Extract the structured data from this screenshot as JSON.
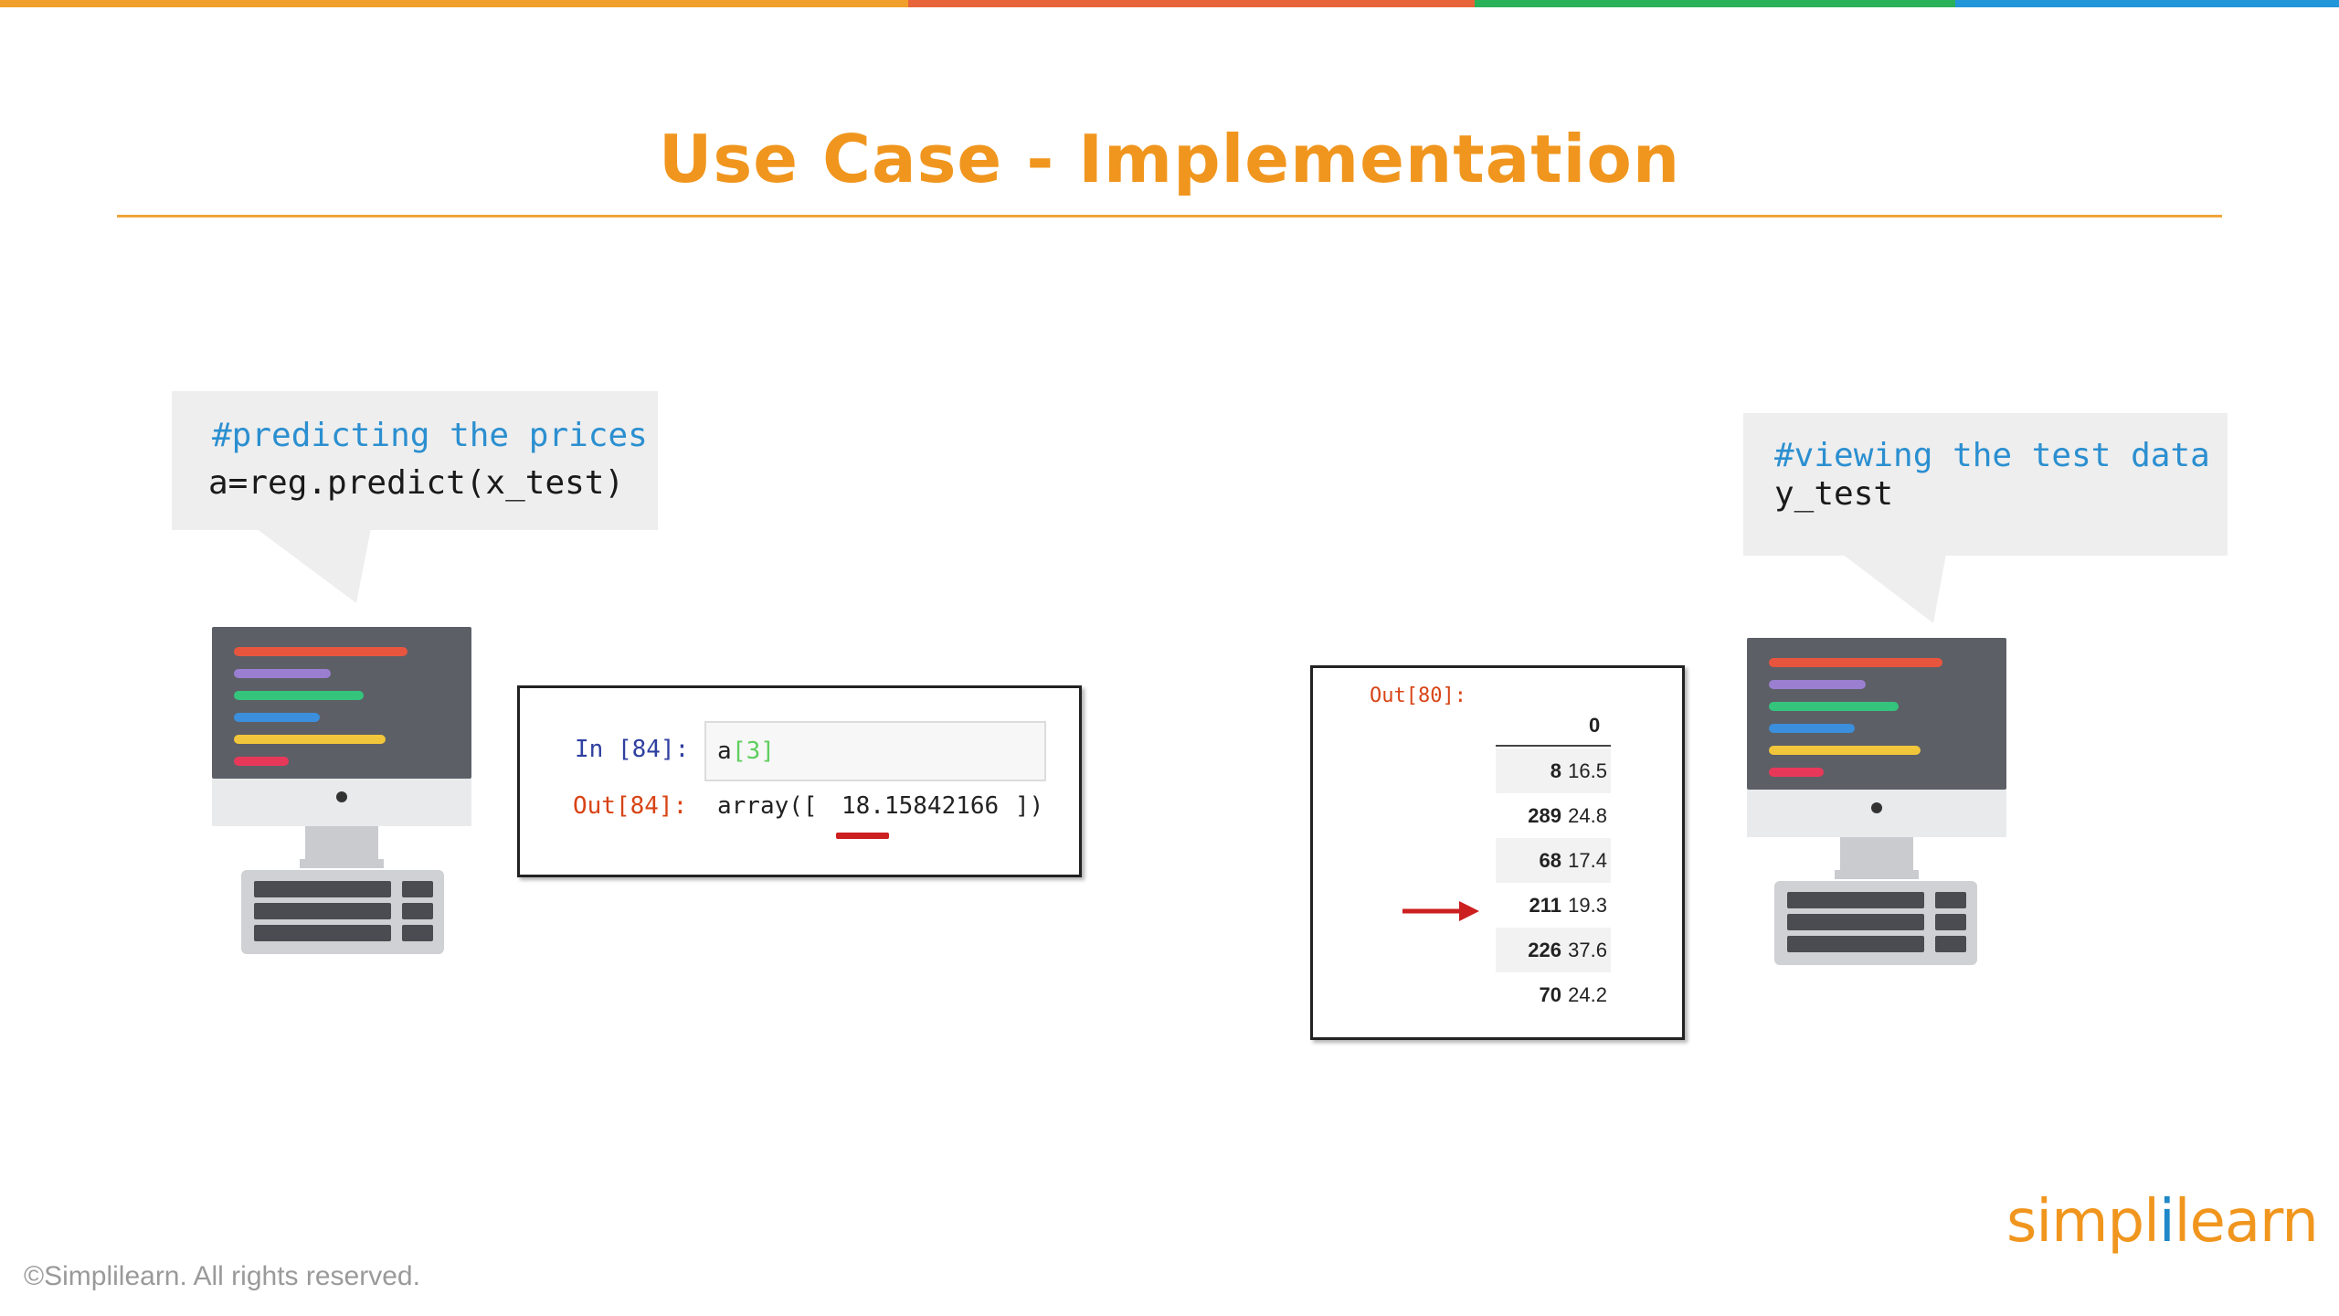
{
  "slide": {
    "title": "Use Case - Implementation",
    "top_bar_colors": [
      "#f0a02a",
      "#e8643a",
      "#2ab25a",
      "#2196d8"
    ]
  },
  "left_bubble": {
    "comment": "#predicting the prices",
    "code": "a=reg.predict(x_test)"
  },
  "right_bubble": {
    "comment": "#viewing the test data",
    "code": "y_test"
  },
  "notebook_left": {
    "in_prompt": "In [84]:",
    "input_code": "a",
    "input_index": "[3]",
    "out_prompt": "Out[84]:",
    "output_prefix": "array([ ",
    "output_value": "18.15842166",
    "output_suffix": "])"
  },
  "notebook_right": {
    "out_prompt": "Out[80]:",
    "column_header": "0",
    "rows": [
      {
        "index": "8",
        "value": "16.5"
      },
      {
        "index": "289",
        "value": "24.8"
      },
      {
        "index": "68",
        "value": "17.4"
      },
      {
        "index": "211",
        "value": "19.3"
      },
      {
        "index": "226",
        "value": "37.6"
      },
      {
        "index": "70",
        "value": "24.2"
      }
    ]
  },
  "footer": {
    "copyright": "©Simplilearn. All rights reserved.",
    "logo_part1": "simpl",
    "logo_mark": "i",
    "logo_part2": "learn"
  },
  "colors": {
    "title_orange": "#f0961e",
    "comment_blue": "#2b8fd0",
    "highlight_red": "#cc1f1f"
  }
}
